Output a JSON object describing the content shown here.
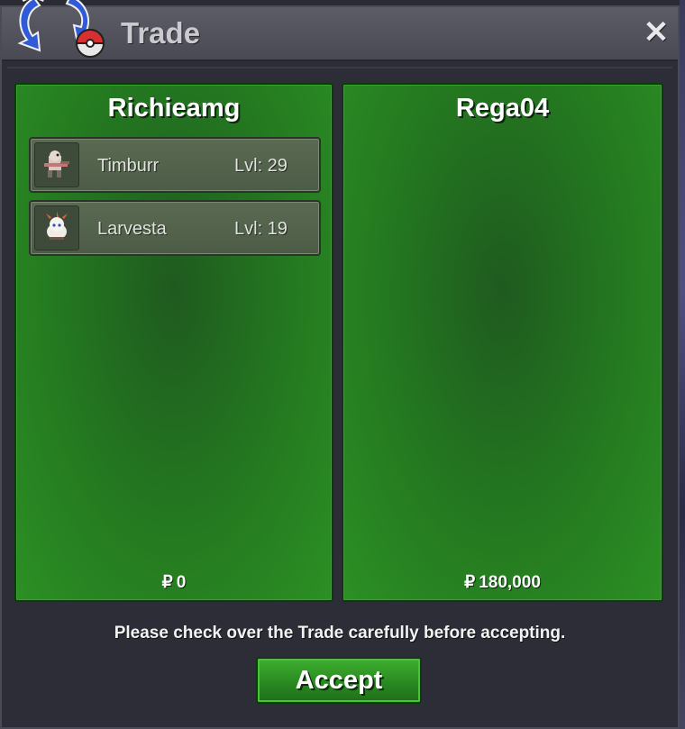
{
  "window": {
    "title": "Trade",
    "close_label": "✕"
  },
  "panels": [
    {
      "player_name": "Richieamg",
      "money_symbol": "₽",
      "money": "0",
      "items": [
        {
          "name": "Timburr",
          "level": "Lvl: 29",
          "icon": "timburr-sprite"
        },
        {
          "name": "Larvesta",
          "level": "Lvl: 19",
          "icon": "larvesta-sprite"
        }
      ]
    },
    {
      "player_name": "Rega04",
      "money_symbol": "₽",
      "money": "180,000",
      "items": []
    }
  ],
  "footer": {
    "notice": "Please check over the Trade carefully before accepting.",
    "accept_label": "Accept"
  },
  "colors": {
    "panel_green": "#247a20",
    "button_green": "#2a8a22",
    "window_bg": "#2d2d38",
    "titlebar": "#4a4a54"
  }
}
